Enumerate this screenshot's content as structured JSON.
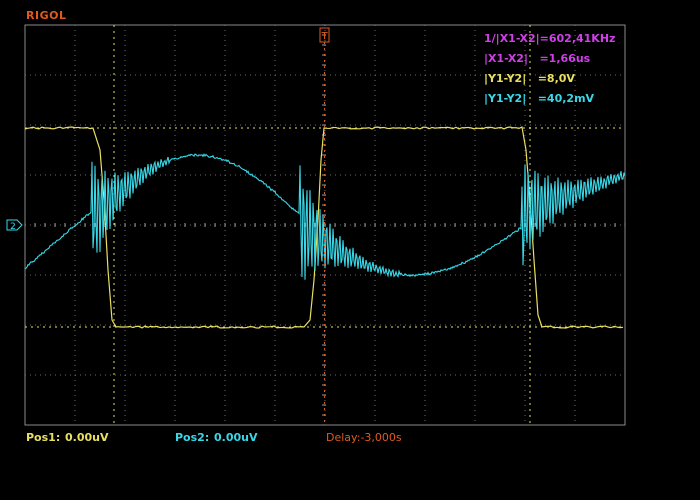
{
  "brand": "RIGOL",
  "cursor_readouts": [
    {
      "text": "1/|X1-X2|=602,41KHz",
      "color": "#d040e8"
    },
    {
      "text": "|X1-X2|   =1,66us",
      "color": "#d040e8"
    },
    {
      "text": "|Y1-Y2|   =8,0V",
      "color": "#e8e060"
    },
    {
      "text": "|Y1-Y2|   =40,2mV",
      "color": "#38d8e8"
    }
  ],
  "bottom": {
    "pos1_label": "Pos1:",
    "pos1_value": "0.00uV",
    "pos2_label": "Pos2:",
    "pos2_value": "0.00uV",
    "delay": "Delay:-3,000s"
  },
  "channel_marker": "2",
  "trigger_marker": "T",
  "colors": {
    "ch1": "#e8e060",
    "ch2": "#38d8e8",
    "cursor_measure": "#d040e8",
    "brand": "#e05a1e",
    "grid": "#8a8a8a"
  }
}
